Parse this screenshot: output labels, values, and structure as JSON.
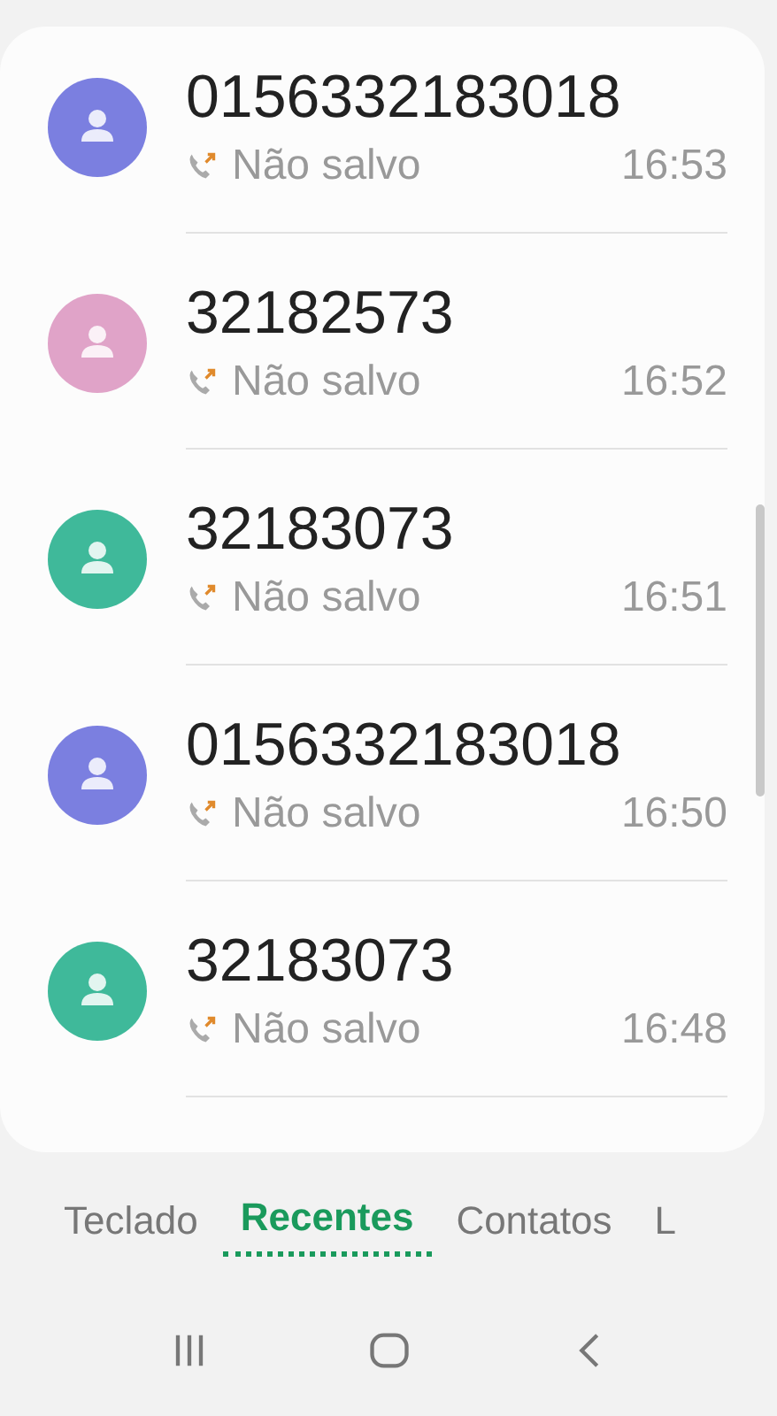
{
  "calls": [
    {
      "number": "0156332183018",
      "status": "Não salvo",
      "time": "16:53",
      "color": "#7b7fe0"
    },
    {
      "number": "32182573",
      "status": "Não salvo",
      "time": "16:52",
      "color": "#e0a3c8"
    },
    {
      "number": "32183073",
      "status": "Não salvo",
      "time": "16:51",
      "color": "#3fb99a"
    },
    {
      "number": "0156332183018",
      "status": "Não salvo",
      "time": "16:50",
      "color": "#7b7fe0"
    },
    {
      "number": "32183073",
      "status": "Não salvo",
      "time": "16:48",
      "color": "#3fb99a"
    }
  ],
  "tabs": [
    {
      "label": "Teclado",
      "selected": false
    },
    {
      "label": "Recentes",
      "selected": true
    },
    {
      "label": "Contatos",
      "selected": false
    },
    {
      "label": "L",
      "selected": false
    }
  ]
}
